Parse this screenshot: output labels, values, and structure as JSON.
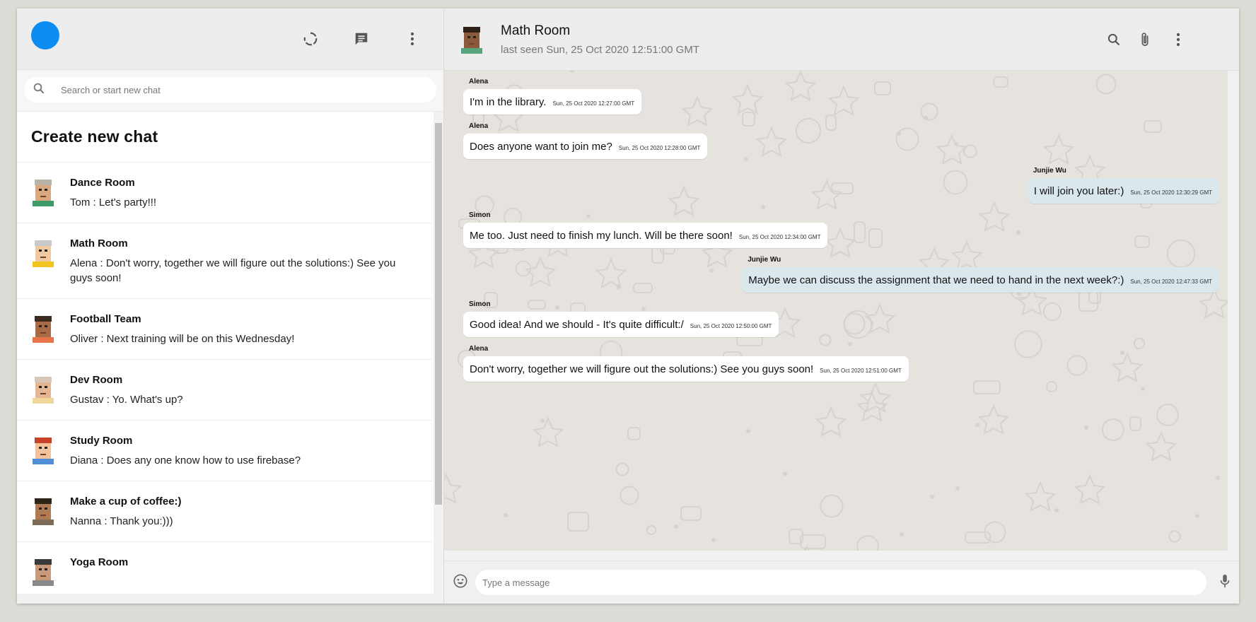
{
  "sidebar": {
    "search_placeholder": "Search or start new chat",
    "create_title": "Create new chat",
    "chats": [
      {
        "name": "Dance Room",
        "last": "Tom : Let's party!!!",
        "skin": "#d9a87e",
        "hair": "#b8b2a8",
        "shirt": "#3e9c6a"
      },
      {
        "name": "Math Room",
        "last": "Alena : Don't worry, together we will figure out the solutions:) See you guys soon!",
        "skin": "#f1c9a0",
        "hair": "#c9c9c9",
        "shirt": "#f2c420"
      },
      {
        "name": "Football Team",
        "last": "Oliver : Next training will be on this Wednesday!",
        "skin": "#a86b45",
        "hair": "#3b2a20",
        "shirt": "#e8744a"
      },
      {
        "name": "Dev Room",
        "last": "Gustav : Yo. What's up?",
        "skin": "#e3b694",
        "hair": "#d6c7b8",
        "shirt": "#f0d69a"
      },
      {
        "name": "Study Room",
        "last": "Diana : Does any one know how to use firebase?",
        "skin": "#f2c29d",
        "hair": "#c7432a",
        "shirt": "#4f8fd8"
      },
      {
        "name": "Make a cup of coffee:)",
        "last": "Nanna : Thank you:)))",
        "skin": "#b07a52",
        "hair": "#2f2418",
        "shirt": "#7d6c5a"
      },
      {
        "name": "Yoga Room",
        "last": "",
        "skin": "#c99a7a",
        "hair": "#3a3a3a",
        "shirt": "#8a8a8a"
      }
    ]
  },
  "chat": {
    "title": "Math Room",
    "subtitle": "last seen Sun, 25 Oct 2020 12:51:00 GMT",
    "input_placeholder": "Type a message",
    "messages": [
      {
        "sender": "Alena",
        "text": "I'm in the library.",
        "time": "Sun, 25 Oct 2020 12:27:00 GMT",
        "mine": false
      },
      {
        "sender": "Alena",
        "text": "Does anyone want to join me?",
        "time": "Sun, 25 Oct 2020 12:28:00 GMT",
        "mine": false
      },
      {
        "sender": "Junjie Wu",
        "text": "I will join you later:)",
        "time": "Sun, 25 Oct 2020 12:30:29 GMT",
        "mine": true
      },
      {
        "sender": "Simon",
        "text": "Me too. Just need to finish my lunch. Will be there soon!",
        "time": "Sun, 25 Oct 2020 12:34:00 GMT",
        "mine": false
      },
      {
        "sender": "Junjie Wu",
        "text": "Maybe we can discuss the assignment that we need to hand in the next week?:)",
        "time": "Sun, 25 Oct 2020 12:47:33 GMT",
        "mine": true
      },
      {
        "sender": "Simon",
        "text": "Good idea! And we should - It's quite difficult:/",
        "time": "Sun, 25 Oct 2020 12:50:00 GMT",
        "mine": false
      },
      {
        "sender": "Alena",
        "text": "Don't worry, together we will figure out the solutions:) See you guys soon!",
        "time": "Sun, 25 Oct 2020 12:51:00 GMT",
        "mine": false
      }
    ]
  },
  "colors": {
    "accent": "#0d8cf2",
    "my_bubble": "#dae8ee",
    "header_bg": "#ededed"
  },
  "icons": [
    "status-icon",
    "new-chat-icon",
    "menu-icon",
    "search-icon",
    "attach-icon",
    "emoji-icon",
    "mic-icon"
  ]
}
